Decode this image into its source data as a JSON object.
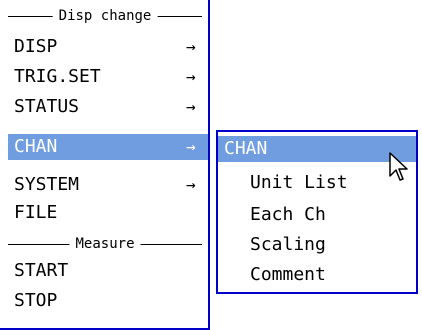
{
  "main_menu": {
    "section_disp": "Disp change",
    "section_measure": "Measure",
    "items": [
      {
        "label": "DISP",
        "arrow": "→"
      },
      {
        "label": "TRIG.SET",
        "arrow": "→"
      },
      {
        "label": "STATUS",
        "arrow": "→"
      },
      {
        "label": "CHAN",
        "arrow": "→"
      },
      {
        "label": "SYSTEM",
        "arrow": "→"
      },
      {
        "label": "FILE",
        "arrow": ""
      },
      {
        "label": "START",
        "arrow": ""
      },
      {
        "label": "STOP",
        "arrow": ""
      }
    ],
    "selected_item": "CHAN"
  },
  "submenu": {
    "title": "CHAN",
    "items": [
      "Unit List",
      "Each Ch",
      "Scaling",
      "Comment"
    ]
  },
  "colors": {
    "highlight": "#6f9de0",
    "border": "#0000c8"
  },
  "icons": {
    "cursor": "mouse-pointer-icon",
    "arrow": "right-arrow-icon"
  }
}
